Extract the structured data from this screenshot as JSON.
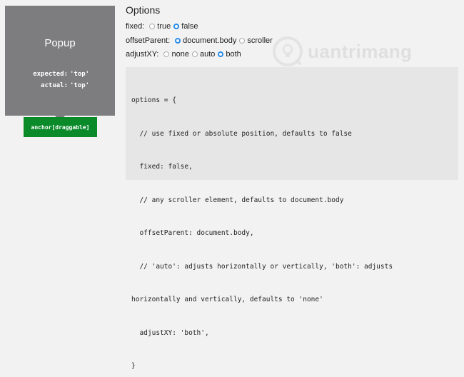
{
  "popup": {
    "title": "Popup",
    "expected_label": "expected:",
    "expected_value": "'top'",
    "actual_label": "actual:",
    "actual_value": "'top'"
  },
  "anchor": {
    "label": "anchor[draggable]"
  },
  "options": {
    "heading": "Options",
    "fixed": {
      "label": "fixed:",
      "choices": [
        "true",
        "false"
      ],
      "selected": "false"
    },
    "offsetParent": {
      "label": "offsetParent:",
      "choices": [
        "document.body",
        "scroller"
      ],
      "selected": "document.body"
    },
    "adjustXY": {
      "label": "adjustXY:",
      "choices": [
        "none",
        "auto",
        "both"
      ],
      "selected": "both"
    }
  },
  "code": {
    "lines": [
      "options = {",
      "  // use fixed or absolute position, defaults to false",
      "  fixed: false,",
      "  // any scroller element, defaults to document.body",
      "  offsetParent: document.body,",
      "  // 'auto': adjusts horizontally or vertically, 'both': adjusts",
      "horizontally and vertically, defaults to 'none'",
      "  adjustXY: 'both',",
      "}"
    ]
  },
  "watermark": {
    "text": "uantrimang",
    "icon": "lightbulb-icon"
  },
  "colors": {
    "popup": "#7d7d7f",
    "anchor": "#0b8a2a",
    "radio_selected": "#2a8ce8",
    "code_bg": "#e6e6e6"
  }
}
